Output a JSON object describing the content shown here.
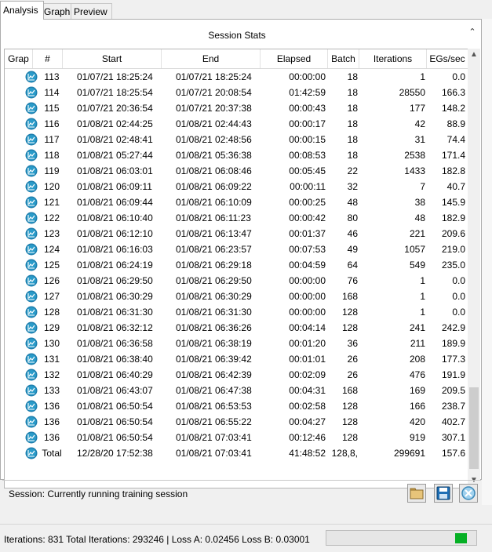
{
  "tabs": [
    {
      "label": "Analysis",
      "active": true
    },
    {
      "label": "Graph",
      "active": false
    },
    {
      "label": "Preview",
      "active": false
    }
  ],
  "stats": {
    "title": "Session Stats",
    "columns": [
      "Grap",
      "#",
      "Start",
      "End",
      "Elapsed",
      "Batch",
      "Iterations",
      "EGs/sec"
    ],
    "rows": [
      {
        "id": "113",
        "start": "01/07/21 18:25:24",
        "end": "01/07/21 18:25:24",
        "elapsed": "00:00:00",
        "batch": "18",
        "iterations": "1",
        "egs": "0.0"
      },
      {
        "id": "114",
        "start": "01/07/21 18:25:54",
        "end": "01/07/21 20:08:54",
        "elapsed": "01:42:59",
        "batch": "18",
        "iterations": "28550",
        "egs": "166.3"
      },
      {
        "id": "115",
        "start": "01/07/21 20:36:54",
        "end": "01/07/21 20:37:38",
        "elapsed": "00:00:43",
        "batch": "18",
        "iterations": "177",
        "egs": "148.2"
      },
      {
        "id": "116",
        "start": "01/08/21 02:44:25",
        "end": "01/08/21 02:44:43",
        "elapsed": "00:00:17",
        "batch": "18",
        "iterations": "42",
        "egs": "88.9"
      },
      {
        "id": "117",
        "start": "01/08/21 02:48:41",
        "end": "01/08/21 02:48:56",
        "elapsed": "00:00:15",
        "batch": "18",
        "iterations": "31",
        "egs": "74.4"
      },
      {
        "id": "118",
        "start": "01/08/21 05:27:44",
        "end": "01/08/21 05:36:38",
        "elapsed": "00:08:53",
        "batch": "18",
        "iterations": "2538",
        "egs": "171.4"
      },
      {
        "id": "119",
        "start": "01/08/21 06:03:01",
        "end": "01/08/21 06:08:46",
        "elapsed": "00:05:45",
        "batch": "22",
        "iterations": "1433",
        "egs": "182.8"
      },
      {
        "id": "120",
        "start": "01/08/21 06:09:11",
        "end": "01/08/21 06:09:22",
        "elapsed": "00:00:11",
        "batch": "32",
        "iterations": "7",
        "egs": "40.7"
      },
      {
        "id": "121",
        "start": "01/08/21 06:09:44",
        "end": "01/08/21 06:10:09",
        "elapsed": "00:00:25",
        "batch": "48",
        "iterations": "38",
        "egs": "145.9"
      },
      {
        "id": "122",
        "start": "01/08/21 06:10:40",
        "end": "01/08/21 06:11:23",
        "elapsed": "00:00:42",
        "batch": "80",
        "iterations": "48",
        "egs": "182.9"
      },
      {
        "id": "123",
        "start": "01/08/21 06:12:10",
        "end": "01/08/21 06:13:47",
        "elapsed": "00:01:37",
        "batch": "46",
        "iterations": "221",
        "egs": "209.6"
      },
      {
        "id": "124",
        "start": "01/08/21 06:16:03",
        "end": "01/08/21 06:23:57",
        "elapsed": "00:07:53",
        "batch": "49",
        "iterations": "1057",
        "egs": "219.0"
      },
      {
        "id": "125",
        "start": "01/08/21 06:24:19",
        "end": "01/08/21 06:29:18",
        "elapsed": "00:04:59",
        "batch": "64",
        "iterations": "549",
        "egs": "235.0"
      },
      {
        "id": "126",
        "start": "01/08/21 06:29:50",
        "end": "01/08/21 06:29:50",
        "elapsed": "00:00:00",
        "batch": "76",
        "iterations": "1",
        "egs": "0.0"
      },
      {
        "id": "127",
        "start": "01/08/21 06:30:29",
        "end": "01/08/21 06:30:29",
        "elapsed": "00:00:00",
        "batch": "168",
        "iterations": "1",
        "egs": "0.0"
      },
      {
        "id": "128",
        "start": "01/08/21 06:31:30",
        "end": "01/08/21 06:31:30",
        "elapsed": "00:00:00",
        "batch": "128",
        "iterations": "1",
        "egs": "0.0"
      },
      {
        "id": "129",
        "start": "01/08/21 06:32:12",
        "end": "01/08/21 06:36:26",
        "elapsed": "00:04:14",
        "batch": "128",
        "iterations": "241",
        "egs": "242.9"
      },
      {
        "id": "130",
        "start": "01/08/21 06:36:58",
        "end": "01/08/21 06:38:19",
        "elapsed": "00:01:20",
        "batch": "36",
        "iterations": "211",
        "egs": "189.9"
      },
      {
        "id": "131",
        "start": "01/08/21 06:38:40",
        "end": "01/08/21 06:39:42",
        "elapsed": "00:01:01",
        "batch": "26",
        "iterations": "208",
        "egs": "177.3"
      },
      {
        "id": "132",
        "start": "01/08/21 06:40:29",
        "end": "01/08/21 06:42:39",
        "elapsed": "00:02:09",
        "batch": "26",
        "iterations": "476",
        "egs": "191.9"
      },
      {
        "id": "133",
        "start": "01/08/21 06:43:07",
        "end": "01/08/21 06:47:38",
        "elapsed": "00:04:31",
        "batch": "168",
        "iterations": "169",
        "egs": "209.5"
      },
      {
        "id": "136",
        "start": "01/08/21 06:50:54",
        "end": "01/08/21 06:53:53",
        "elapsed": "00:02:58",
        "batch": "128",
        "iterations": "166",
        "egs": "238.7"
      },
      {
        "id": "136",
        "start": "01/08/21 06:50:54",
        "end": "01/08/21 06:55:22",
        "elapsed": "00:04:27",
        "batch": "128",
        "iterations": "420",
        "egs": "402.7"
      },
      {
        "id": "136",
        "start": "01/08/21 06:50:54",
        "end": "01/08/21 07:03:41",
        "elapsed": "00:12:46",
        "batch": "128",
        "iterations": "919",
        "egs": "307.1"
      },
      {
        "id": "Total",
        "start": "12/28/20 17:52:38",
        "end": "01/08/21 07:03:41",
        "elapsed": "41:48:52",
        "batch": "128,8,",
        "iterations": "299691",
        "egs": "157.6"
      }
    ]
  },
  "session": {
    "status_text": "Session: Currently running training session"
  },
  "statusbar": {
    "text": "Iterations: 831   Total Iterations: 293246 | Loss A: 0.02456   Loss B: 0.03001",
    "indicator_color": "#06b025"
  },
  "icons": {
    "graph": "graph-line-icon",
    "folder": "folder-icon",
    "save": "save-icon",
    "clear": "clear-icon"
  }
}
